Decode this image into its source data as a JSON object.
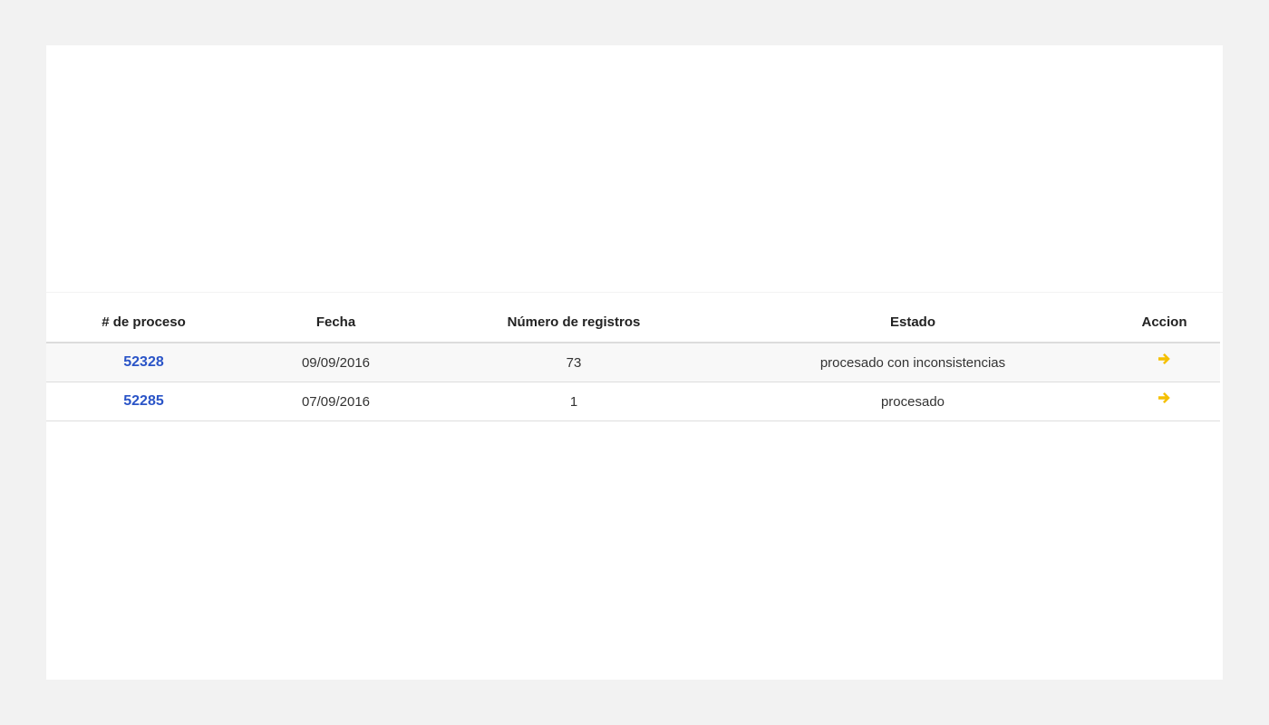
{
  "table": {
    "headers": {
      "proceso": "# de proceso",
      "fecha": "Fecha",
      "registros": "Número de registros",
      "estado": "Estado",
      "accion": "Accion"
    },
    "rows": [
      {
        "proceso": "52328",
        "fecha": "09/09/2016",
        "registros": "73",
        "estado": "procesado con inconsistencias",
        "accion_icon": "arrow-right-icon"
      },
      {
        "proceso": "52285",
        "fecha": "07/09/2016",
        "registros": "1",
        "estado": "procesado",
        "accion_icon": "arrow-right-icon"
      }
    ]
  },
  "colors": {
    "link": "#2a54c7",
    "action_icon": "#f5c000",
    "page_background": "#f2f2f2",
    "panel_background": "#ffffff"
  }
}
